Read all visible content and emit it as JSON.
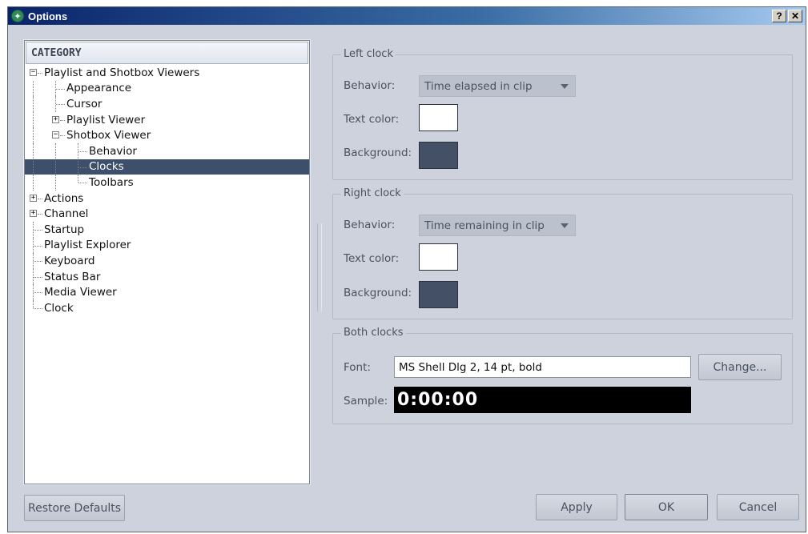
{
  "window": {
    "title": "Options",
    "help_button": "?",
    "close_button": "✕"
  },
  "category": {
    "header": "CATEGORY",
    "items": [
      {
        "label": "Playlist and Shotbox Viewers",
        "level": 0,
        "expander": "−",
        "selected": false
      },
      {
        "label": "Appearance",
        "level": 1,
        "expander": "",
        "selected": false
      },
      {
        "label": "Cursor",
        "level": 1,
        "expander": "",
        "selected": false
      },
      {
        "label": "Playlist Viewer",
        "level": 1,
        "expander": "+",
        "selected": false
      },
      {
        "label": "Shotbox Viewer",
        "level": 1,
        "expander": "−",
        "selected": false
      },
      {
        "label": "Behavior",
        "level": 2,
        "expander": "",
        "selected": false
      },
      {
        "label": "Clocks",
        "level": 2,
        "expander": "",
        "selected": true
      },
      {
        "label": "Toolbars",
        "level": 2,
        "expander": "",
        "selected": false
      },
      {
        "label": "Actions",
        "level": 0,
        "expander": "+",
        "selected": false
      },
      {
        "label": "Channel",
        "level": 0,
        "expander": "+",
        "selected": false
      },
      {
        "label": "Startup",
        "level": 0,
        "expander": "",
        "selected": false
      },
      {
        "label": "Playlist Explorer",
        "level": 0,
        "expander": "",
        "selected": false
      },
      {
        "label": "Keyboard",
        "level": 0,
        "expander": "",
        "selected": false
      },
      {
        "label": "Status Bar",
        "level": 0,
        "expander": "",
        "selected": false
      },
      {
        "label": "Media Viewer",
        "level": 0,
        "expander": "",
        "selected": false
      },
      {
        "label": "Clock",
        "level": 0,
        "expander": "",
        "selected": false
      }
    ]
  },
  "left_clock": {
    "title": "Left clock",
    "behavior_label": "Behavior:",
    "behavior_value": "Time elapsed in clip",
    "text_color_label": "Text color:",
    "text_color": "#ffffff",
    "background_label": "Background:",
    "background_color": "#435066"
  },
  "right_clock": {
    "title": "Right clock",
    "behavior_label": "Behavior:",
    "behavior_value": "Time remaining in clip",
    "text_color_label": "Text color:",
    "text_color": "#ffffff",
    "background_label": "Background:",
    "background_color": "#435066"
  },
  "both_clocks": {
    "title": "Both clocks",
    "font_label": "Font:",
    "font_value": "MS Shell Dlg 2, 14 pt, bold",
    "change_button": "Change...",
    "sample_label": "Sample:",
    "sample_text": "0:00:00"
  },
  "footer": {
    "restore_defaults": "Restore Defaults",
    "apply": "Apply",
    "ok": "OK",
    "cancel": "Cancel"
  }
}
